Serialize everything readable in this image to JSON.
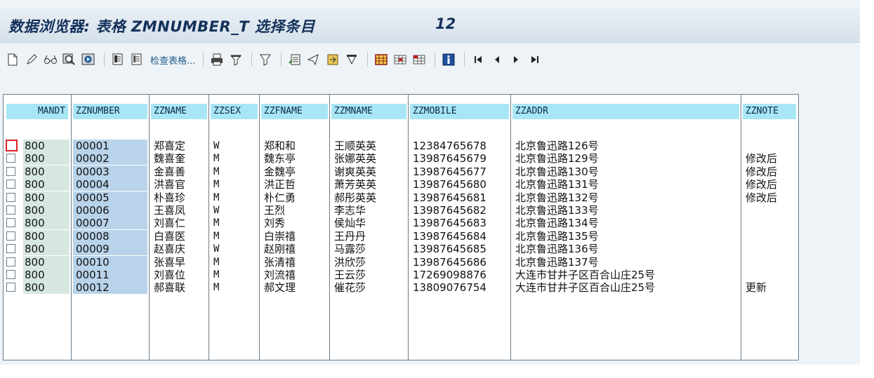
{
  "window": {
    "title": "数据浏览器: 表格 ZMNUMBER_T 选择条目",
    "entry_count": "12"
  },
  "toolbar": {
    "items": [
      {
        "icon": "new-document-icon"
      },
      {
        "icon": "edit-pencil-icon"
      },
      {
        "icon": "glasses-display-icon"
      },
      {
        "icon": "where-used-icon"
      },
      {
        "icon": "refresh-icon"
      },
      {
        "icon": "check-table-icon"
      },
      {
        "icon": "check-table-2-icon"
      }
    ],
    "check_table_label": "检查表格..."
  },
  "table": {
    "columns": [
      "MANDT",
      "ZZNUMBER",
      "ZZNAME",
      "ZZSEX",
      "ZZFNAME",
      "ZZMNAME",
      "ZZMOBILE",
      "ZZADDR",
      "ZZNOTE"
    ],
    "rows": [
      {
        "mandt": "800",
        "number": "00001",
        "name": "郑喜定",
        "sex": "W",
        "fname": "郑和和",
        "mname": "王顺英英",
        "mobile": "12384765678",
        "addr": "北京鲁迅路126号",
        "note": ""
      },
      {
        "mandt": "800",
        "number": "00002",
        "name": "魏喜奎",
        "sex": "M",
        "fname": "魏东亭",
        "mname": "张娜英英",
        "mobile": "13987645679",
        "addr": "北京鲁迅路129号",
        "note": "修改后"
      },
      {
        "mandt": "800",
        "number": "00003",
        "name": "金喜善",
        "sex": "M",
        "fname": "金魏亭",
        "mname": "谢爽英英",
        "mobile": "13987645677",
        "addr": "北京鲁迅路130号",
        "note": "修改后"
      },
      {
        "mandt": "800",
        "number": "00004",
        "name": "洪喜官",
        "sex": "M",
        "fname": "洪正哲",
        "mname": "萧芳英英",
        "mobile": "13987645680",
        "addr": "北京鲁迅路131号",
        "note": "修改后"
      },
      {
        "mandt": "800",
        "number": "00005",
        "name": "朴喜珍",
        "sex": "M",
        "fname": "朴仁勇",
        "mname": "郝彤英英",
        "mobile": "13987645681",
        "addr": "北京鲁迅路132号",
        "note": "修改后"
      },
      {
        "mandt": "800",
        "number": "00006",
        "name": "王喜凤",
        "sex": "W",
        "fname": "王烈",
        "mname": "李志华",
        "mobile": "13987645682",
        "addr": "北京鲁迅路133号",
        "note": ""
      },
      {
        "mandt": "800",
        "number": "00007",
        "name": "刘喜仁",
        "sex": "M",
        "fname": "刘秀",
        "mname": "侯灿华",
        "mobile": "13987645683",
        "addr": "北京鲁迅路134号",
        "note": ""
      },
      {
        "mandt": "800",
        "number": "00008",
        "name": "白喜医",
        "sex": "M",
        "fname": "白崇禧",
        "mname": "王丹丹",
        "mobile": "13987645684",
        "addr": "北京鲁迅路135号",
        "note": ""
      },
      {
        "mandt": "800",
        "number": "00009",
        "name": "赵喜庆",
        "sex": "W",
        "fname": "赵刚禧",
        "mname": "马露莎",
        "mobile": "13987645685",
        "addr": "北京鲁迅路136号",
        "note": ""
      },
      {
        "mandt": "800",
        "number": "00010",
        "name": "张喜早",
        "sex": "M",
        "fname": "张清禧",
        "mname": "洪欣莎",
        "mobile": "13987645686",
        "addr": "北京鲁迅路137号",
        "note": ""
      },
      {
        "mandt": "800",
        "number": "00011",
        "name": "刘喜位",
        "sex": "M",
        "fname": "刘流禧",
        "mname": "王云莎",
        "mobile": "17269098876",
        "addr": "大连市甘井子区百合山庄25号",
        "note": ""
      },
      {
        "mandt": "800",
        "number": "00012",
        "name": "郝喜联",
        "sex": "M",
        "fname": "郝文理",
        "mname": "催花莎",
        "mobile": "13809076754",
        "addr": "大连市甘井子区百合山庄25号",
        "note": "更新"
      }
    ]
  },
  "colors": {
    "title_text": "#14325a",
    "header_bg": "#a9e6f5",
    "mandt_bg": "#d6e7e0",
    "number_bg": "#b8d3ea",
    "focus_border": "#dd2222"
  }
}
